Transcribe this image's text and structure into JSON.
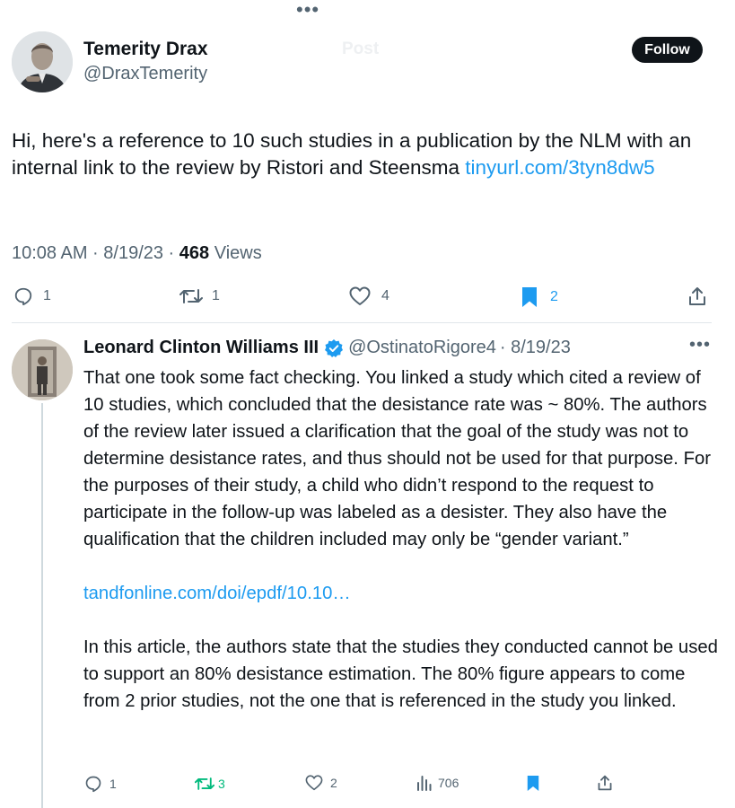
{
  "header": {
    "title": "Post"
  },
  "main_post": {
    "author_name": "Temerity Drax",
    "author_handle": "@DraxTemerity",
    "follow_label": "Follow",
    "text_before_link": "Hi, here's a reference to 10 such studies in a publication by the NLM with an internal link to the review by Ristori and Steensma ",
    "link_text": "tinyurl.com/​3tyn8dw5",
    "time_date": "10:08 AM · 8/19/23 · ",
    "views_count": "468",
    "views_label": " Views",
    "actions": {
      "replies": "1",
      "reposts": "1",
      "likes": "4",
      "bookmarks": "2"
    }
  },
  "reply": {
    "author_name": "Leonard Clinton Williams III",
    "author_handle": "@OstinatoRigore4",
    "date": "· 8/19/23",
    "paragraph1": "That one took some fact checking. You linked a study which cited a review of 10 studies, which concluded that the desistance rate was ~ 80%. The authors of the review later issued a clarification that the goal of the study was not to determine desistance rates, and thus should not be used for that purpose. For the purposes of their study, a child who didn’t respond to the request to participate in the follow-up was labeled as a desister. They also have the qualification that the children included may only be “gender variant.”",
    "link_text": "tandfonline.com/doi/epdf/10.10…",
    "paragraph2": "In this article, the authors state that the studies they conducted cannot be used to support an 80% desistance estimation. The 80% figure appears to come from 2 prior studies, not the one that is referenced in the study you linked.",
    "actions": {
      "replies": "1",
      "reposts": "3",
      "likes": "2",
      "views": "706"
    }
  },
  "colors": {
    "accent": "#1d9bf0",
    "repost_active": "#00ba7c",
    "text": "#0f1419",
    "muted": "#536471"
  }
}
